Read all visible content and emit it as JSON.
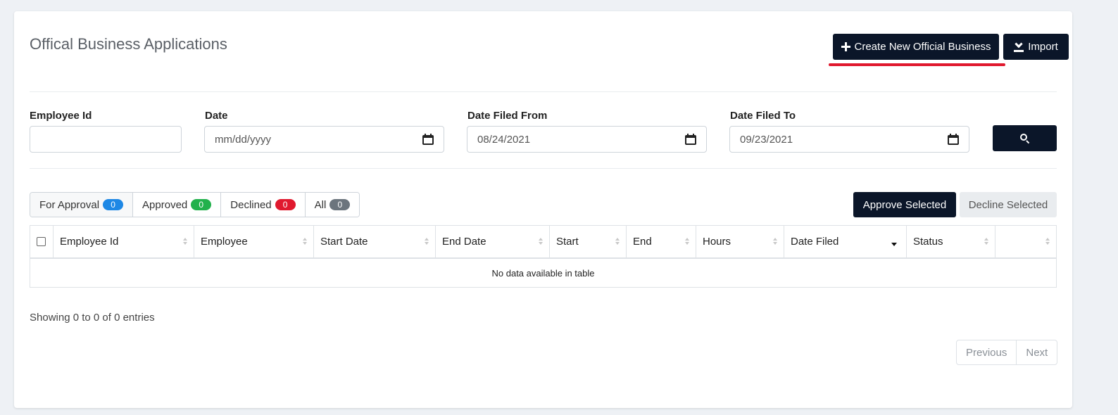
{
  "page": {
    "title": "Offical Business Applications",
    "create_button": "Create New Official Business",
    "import_button": "Import"
  },
  "filters": {
    "employee_id": {
      "label": "Employee Id",
      "value": ""
    },
    "date": {
      "label": "Date",
      "value": "mm/dd/yyyy"
    },
    "date_filed_from": {
      "label": "Date Filed From",
      "value": "08/24/2021"
    },
    "date_filed_to": {
      "label": "Date Filed To",
      "value": "09/23/2021"
    }
  },
  "tabs": [
    {
      "label": "For Approval",
      "count": "0",
      "color": "#1e88e5"
    },
    {
      "label": "Approved",
      "count": "0",
      "color": "#22b14c"
    },
    {
      "label": "Declined",
      "count": "0",
      "color": "#e0192e"
    },
    {
      "label": "All",
      "count": "0",
      "color": "#6c757d"
    }
  ],
  "actions": {
    "approve": "Approve Selected",
    "decline": "Decline Selected"
  },
  "table": {
    "columns": [
      "Employee Id",
      "Employee",
      "Start Date",
      "End Date",
      "Start",
      "End",
      "Hours",
      "Date Filed",
      "Status",
      ""
    ],
    "empty_message": "No data available in table"
  },
  "footer": {
    "info": "Showing 0 to 0 of 0 entries",
    "previous": "Previous",
    "next": "Next"
  },
  "icons": {
    "create": "plus-icon",
    "import": "import-icon",
    "calendar": "calendar-icon",
    "search": "search-icon"
  },
  "colors": {
    "primary_dark": "#0b1629",
    "highlight_underline": "#e0192e"
  }
}
